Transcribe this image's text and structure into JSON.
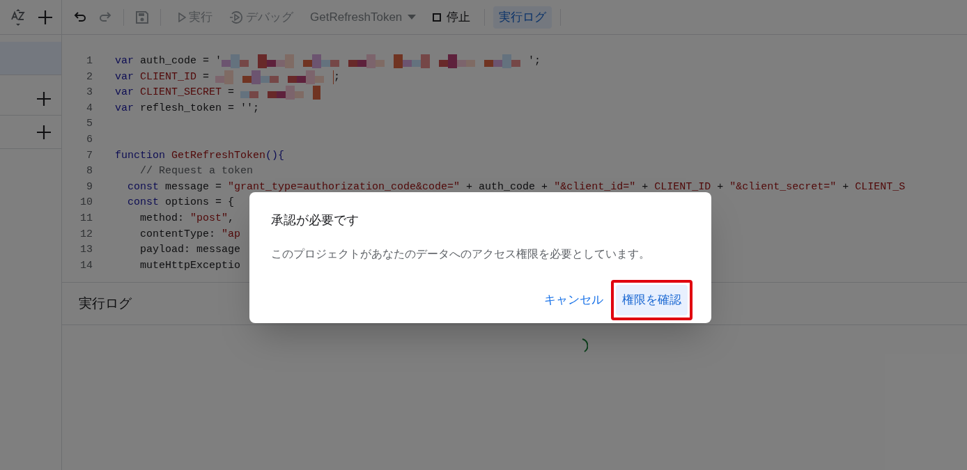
{
  "toolbar": {
    "run": "実行",
    "debug": "デバッグ",
    "function_select": "GetRefreshToken",
    "stop": "停止",
    "log_button": {
      "label": "実行ログ",
      "selected": true
    }
  },
  "sidebar": {
    "items": [
      {
        "selected": true
      },
      {
        "selected": false
      },
      {
        "selected": false
      }
    ]
  },
  "editor": {
    "lines": [
      {
        "number": "1",
        "tokens": [
          {
            "kind": "kw",
            "text": "var "
          },
          {
            "kind": "plain",
            "text": "auth_code = '"
          },
          {
            "kind": "redacted"
          },
          {
            "kind": "plain",
            "text": "';"
          }
        ]
      },
      {
        "number": "2",
        "tokens": [
          {
            "kind": "kw",
            "text": "var "
          },
          {
            "kind": "const",
            "text": "CLIENT_ID"
          },
          {
            "kind": "plain",
            "text": " = "
          },
          {
            "kind": "redacted"
          },
          {
            "kind": "plain",
            "text": ";"
          }
        ]
      },
      {
        "number": "3",
        "tokens": [
          {
            "kind": "kw",
            "text": "var "
          },
          {
            "kind": "const",
            "text": "CLIENT_SECRET"
          },
          {
            "kind": "plain",
            "text": " = "
          },
          {
            "kind": "redacted"
          }
        ]
      },
      {
        "number": "4",
        "tokens": [
          {
            "kind": "kw",
            "text": "var "
          },
          {
            "kind": "plain",
            "text": "reflesh_token = '';"
          }
        ]
      },
      {
        "number": "5"
      },
      {
        "number": "6"
      },
      {
        "number": "7",
        "tokens": [
          {
            "kind": "kw",
            "text": "function "
          },
          {
            "kind": "const",
            "text": "GetRefreshToken"
          },
          {
            "kind": "kw",
            "text": "(){"
          }
        ]
      },
      {
        "number": "8",
        "tokens": [
          {
            "kind": "comment",
            "text": "    // Request a token"
          }
        ]
      },
      {
        "number": "9",
        "tokens": [
          {
            "kind": "kw",
            "text": "  const "
          },
          {
            "kind": "plain",
            "text": "message = "
          },
          {
            "kind": "str",
            "text": "\"grant_type=authorization_code&code=\""
          },
          {
            "kind": "plain",
            "text": " + auth_code + "
          },
          {
            "kind": "str",
            "text": "\"&client_id=\""
          },
          {
            "kind": "plain",
            "text": " + "
          },
          {
            "kind": "const",
            "text": "CLIENT_ID"
          },
          {
            "kind": "plain",
            "text": " + "
          },
          {
            "kind": "str",
            "text": "\"&client_secret=\""
          },
          {
            "kind": "plain",
            "text": " + "
          },
          {
            "kind": "const",
            "text": "CLIENT_S"
          }
        ]
      },
      {
        "number": "10",
        "tokens": [
          {
            "kind": "kw",
            "text": "  const "
          },
          {
            "kind": "plain",
            "text": "options = {"
          }
        ]
      },
      {
        "number": "11",
        "tokens": [
          {
            "kind": "plain",
            "text": "    method: "
          },
          {
            "kind": "str",
            "text": "\"post\""
          },
          {
            "kind": "plain",
            "text": ","
          }
        ]
      },
      {
        "number": "12",
        "tokens": [
          {
            "kind": "plain",
            "text": "    contentType: "
          },
          {
            "kind": "str",
            "text": "\"ap"
          }
        ]
      },
      {
        "number": "13",
        "tokens": [
          {
            "kind": "plain",
            "text": "    payload: message"
          }
        ]
      },
      {
        "number": "14",
        "tokens": [
          {
            "kind": "plain",
            "text": "    muteHttpExceptio"
          }
        ]
      }
    ]
  },
  "log_panel": {
    "title": "実行ログ"
  },
  "dialog": {
    "title": "承認が必要です",
    "message": "このプロジェクトがあなたのデータへのアクセス権限を必要としています。",
    "cancel": "キャンセル",
    "confirm": "権限を確認",
    "confirm_highlighted": true
  }
}
